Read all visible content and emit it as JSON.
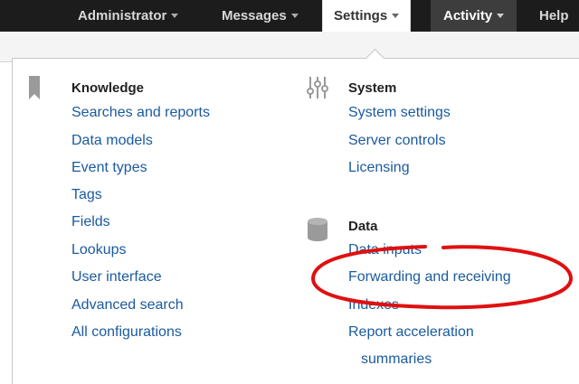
{
  "topnav": {
    "items": [
      {
        "label": "Administrator"
      },
      {
        "label": "Messages"
      },
      {
        "label": "Settings"
      },
      {
        "label": "Activity"
      },
      {
        "label": "Help"
      }
    ]
  },
  "menu": {
    "knowledge": {
      "title": "Knowledge",
      "icon": "bookmark-icon",
      "links": [
        "Searches and reports",
        "Data models",
        "Event types",
        "Tags",
        "Fields",
        "Lookups",
        "User interface",
        "Advanced search",
        "All configurations"
      ]
    },
    "system": {
      "title": "System",
      "icon": "sliders-icon",
      "links": [
        "System settings",
        "Server controls",
        "Licensing"
      ]
    },
    "data": {
      "title": "Data",
      "icon": "database-icon",
      "links": [
        "Data inputs",
        "Forwarding and receiving",
        "Indexes",
        "Report acceleration",
        "summaries"
      ]
    }
  },
  "colors": {
    "nav_bg": "#1c1c1c",
    "link": "#1a5a9e",
    "annotation": "#e01010"
  }
}
